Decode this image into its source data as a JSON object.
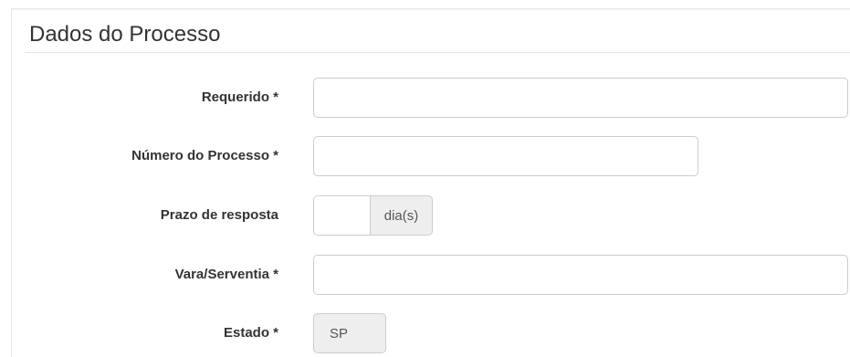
{
  "section": {
    "title": "Dados do Processo"
  },
  "form": {
    "requerido": {
      "label": "Requerido *",
      "value": ""
    },
    "numero_processo": {
      "label": "Número do Processo *",
      "value": ""
    },
    "prazo_resposta": {
      "label": "Prazo de resposta",
      "value": "",
      "addon": "dia(s)"
    },
    "vara_serventia": {
      "label": "Vara/Serventia *",
      "value": ""
    },
    "estado": {
      "label": "Estado *",
      "value": "SP"
    }
  }
}
